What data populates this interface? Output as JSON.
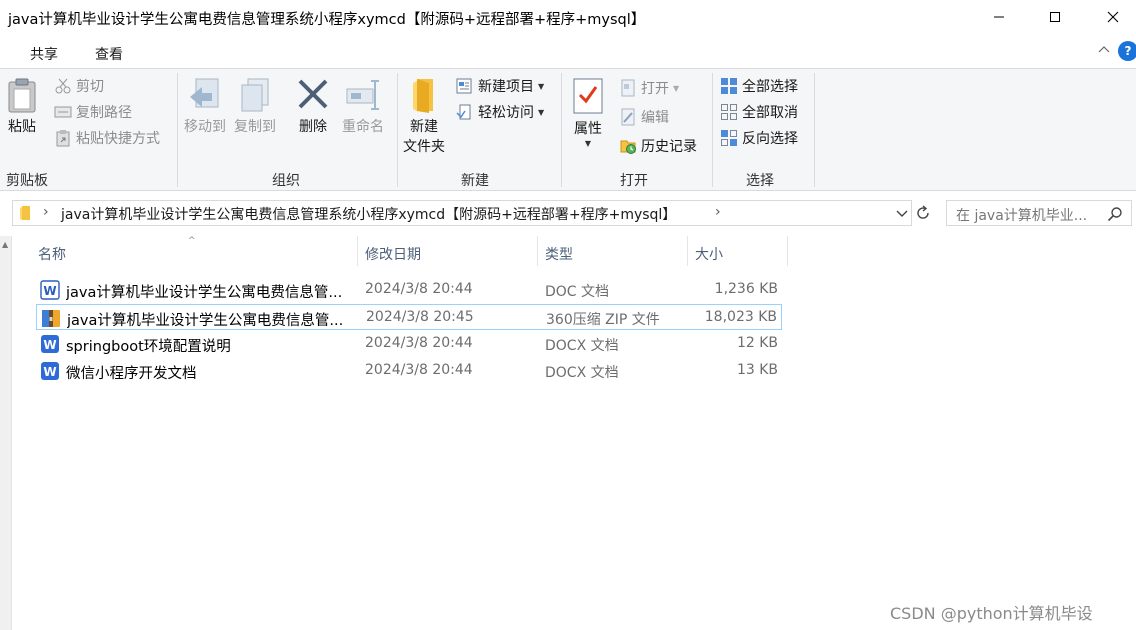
{
  "window": {
    "title": "java计算机毕业设计学生公寓电费信息管理系统小程序xymcd【附源码+远程部署+程序+mysql】"
  },
  "ribbon_tabs": [
    "共享",
    "查看"
  ],
  "ribbon": {
    "clipboard": {
      "paste": "粘贴",
      "cut": "剪切",
      "copy_path": "复制路径",
      "paste_shortcut": "粘贴快捷方式",
      "group": "剪贴板"
    },
    "organize": {
      "move_to": "移动到",
      "copy_to": "复制到",
      "delete": "删除",
      "rename": "重命名",
      "group": "组织"
    },
    "new": {
      "new_folder": "新建\n文件夹",
      "new_item": "新建项目",
      "easy_access": "轻松访问",
      "group": "新建"
    },
    "open": {
      "properties": "属性",
      "open": "打开",
      "edit": "编辑",
      "history": "历史记录",
      "group": "打开"
    },
    "select": {
      "select_all": "全部选择",
      "select_none": "全部取消",
      "invert": "反向选择",
      "group": "选择"
    }
  },
  "address": {
    "path": "java计算机毕业设计学生公寓电费信息管理系统小程序xymcd【附源码+远程部署+程序+mysql】",
    "search_placeholder": "在 java计算机毕业..."
  },
  "columns": {
    "name": "名称",
    "date": "修改日期",
    "type": "类型",
    "size": "大小"
  },
  "files": [
    {
      "name": "java计算机毕业设计学生公寓电费信息管...",
      "date": "2024/3/8 20:44",
      "type": "DOC 文档",
      "size": "1,236 KB",
      "icon": "word-icon"
    },
    {
      "name": "java计算机毕业设计学生公寓电费信息管...",
      "date": "2024/3/8 20:45",
      "type": "360压缩 ZIP 文件",
      "size": "18,023 KB",
      "icon": "zip-icon"
    },
    {
      "name": "springboot环境配置说明",
      "date": "2024/3/8 20:44",
      "type": "DOCX 文档",
      "size": "12 KB",
      "icon": "word-icon"
    },
    {
      "name": "微信小程序开发文档",
      "date": "2024/3/8 20:44",
      "type": "DOCX 文档",
      "size": "13 KB",
      "icon": "word-icon"
    }
  ],
  "watermark": "CSDN @python计算机毕设",
  "colors": {
    "accent": "#1a73d9",
    "selection_border": "#99d1ff",
    "header_text": "#4c607a"
  }
}
